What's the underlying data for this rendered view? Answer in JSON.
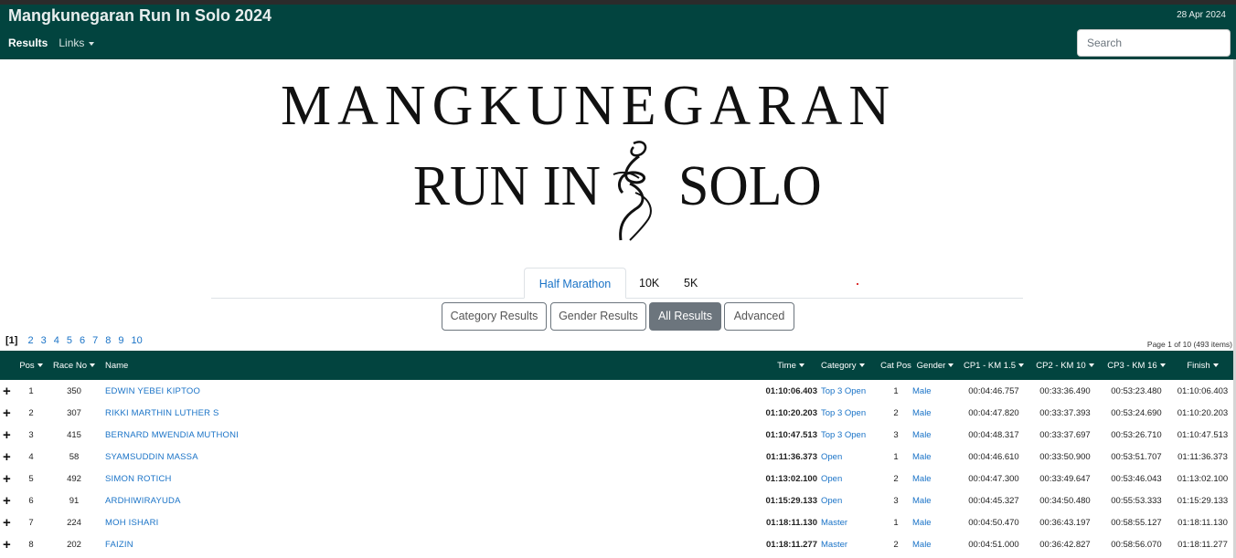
{
  "header": {
    "title": "Mangkunegaran Run In Solo 2024",
    "date": "28 Apr 2024",
    "nav_results": "Results",
    "nav_links": "Links",
    "search_placeholder": "Search"
  },
  "logo": {
    "line1": "MANGKUNEGARAN",
    "run_in": "RUN IN",
    "solo": "SOLO"
  },
  "tabs": {
    "half_marathon": "Half Marathon",
    "ten_k": "10K",
    "five_k": "5K"
  },
  "buttons": {
    "category": "Category Results",
    "gender": "Gender Results",
    "all": "All Results",
    "advanced": "Advanced"
  },
  "pager": {
    "current": "[1]",
    "pages": [
      "2",
      "3",
      "4",
      "5",
      "6",
      "7",
      "8",
      "9",
      "10"
    ],
    "info": "Page 1 of 10 (493 items)"
  },
  "table": {
    "headers": {
      "pos": "Pos",
      "race_no": "Race No",
      "name": "Name",
      "time": "Time",
      "category": "Category",
      "cat_pos": "Cat Pos",
      "gender": "Gender",
      "cp1": "CP1 - KM 1.5",
      "cp2": "CP2 - KM 10",
      "cp3": "CP3 - KM 16",
      "finish": "Finish"
    },
    "rows": [
      {
        "expand": "+",
        "pos": "1",
        "race_no": "350",
        "name": "EDWIN YEBEI KIPTOO",
        "time": "01:10:06.403",
        "category": "Top 3 Open",
        "cat_pos": "1",
        "gender": "Male",
        "cp1": "00:04:46.757",
        "cp2": "00:33:36.490",
        "cp3": "00:53:23.480",
        "finish": "01:10:06.403"
      },
      {
        "expand": "+",
        "pos": "2",
        "race_no": "307",
        "name": "RIKKI MARTHIN LUTHER S",
        "time": "01:10:20.203",
        "category": "Top 3 Open",
        "cat_pos": "2",
        "gender": "Male",
        "cp1": "00:04:47.820",
        "cp2": "00:33:37.393",
        "cp3": "00:53:24.690",
        "finish": "01:10:20.203"
      },
      {
        "expand": "+",
        "pos": "3",
        "race_no": "415",
        "name": "BERNARD MWENDIA MUTHONI",
        "time": "01:10:47.513",
        "category": "Top 3 Open",
        "cat_pos": "3",
        "gender": "Male",
        "cp1": "00:04:48.317",
        "cp2": "00:33:37.697",
        "cp3": "00:53:26.710",
        "finish": "01:10:47.513"
      },
      {
        "expand": "+",
        "pos": "4",
        "race_no": "58",
        "name": "SYAMSUDDIN MASSA",
        "time": "01:11:36.373",
        "category": "Open",
        "cat_pos": "1",
        "gender": "Male",
        "cp1": "00:04:46.610",
        "cp2": "00:33:50.900",
        "cp3": "00:53:51.707",
        "finish": "01:11:36.373"
      },
      {
        "expand": "+",
        "pos": "5",
        "race_no": "492",
        "name": "SIMON ROTICH",
        "time": "01:13:02.100",
        "category": "Open",
        "cat_pos": "2",
        "gender": "Male",
        "cp1": "00:04:47.300",
        "cp2": "00:33:49.647",
        "cp3": "00:53:46.043",
        "finish": "01:13:02.100"
      },
      {
        "expand": "+",
        "pos": "6",
        "race_no": "91",
        "name": "ARDHIWIRAYUDA",
        "time": "01:15:29.133",
        "category": "Open",
        "cat_pos": "3",
        "gender": "Male",
        "cp1": "00:04:45.327",
        "cp2": "00:34:50.480",
        "cp3": "00:55:53.333",
        "finish": "01:15:29.133"
      },
      {
        "expand": "+",
        "pos": "7",
        "race_no": "224",
        "name": "MOH ISHARI",
        "time": "01:18:11.130",
        "category": "Master",
        "cat_pos": "1",
        "gender": "Male",
        "cp1": "00:04:50.470",
        "cp2": "00:36:43.197",
        "cp3": "00:58:55.127",
        "finish": "01:18:11.130"
      },
      {
        "expand": "+",
        "pos": "8",
        "race_no": "202",
        "name": "FAIZIN",
        "time": "01:18:11.277",
        "category": "Master",
        "cat_pos": "2",
        "gender": "Male",
        "cp1": "00:04:51.000",
        "cp2": "00:36:42.827",
        "cp3": "00:58:56.070",
        "finish": "01:18:11.277"
      }
    ]
  },
  "colors": {
    "header_bg": "#02443f",
    "link": "#1a73c7",
    "button_active": "#6c757d"
  }
}
